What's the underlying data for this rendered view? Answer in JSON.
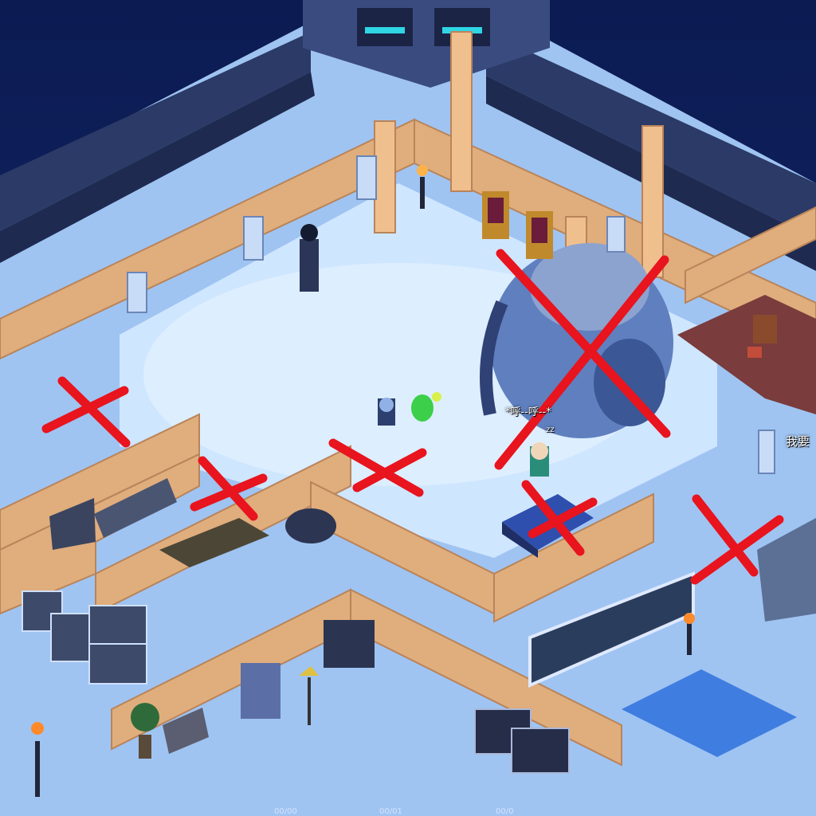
{
  "scene": {
    "colors": {
      "sky": "#0b1a4a",
      "snow": "#cfe6ff",
      "snow_shadow": "#9fc4f2",
      "wood_wall": "#e0ad7c",
      "wood_wall_dark": "#b9845a",
      "stone_wall": "#2b3a66",
      "brick_floor": "#7a3c3c",
      "ice_floor": "#3f7de0",
      "red_mark": "#e8141e"
    },
    "labels": {
      "player_name": "*呼--呼--*",
      "sleep_indicator": "zz",
      "edge_text": "我要"
    },
    "hud_fragments": [
      "00/00",
      "00/01",
      "00/0"
    ]
  }
}
